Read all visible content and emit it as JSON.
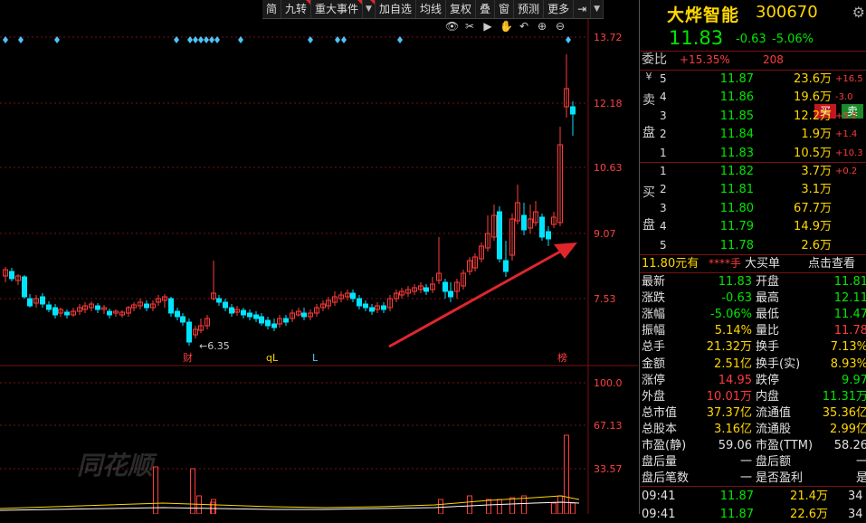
{
  "toolbar": {
    "items": [
      "简",
      "九转",
      "重大事件",
      "▼",
      "加自选",
      "均线",
      "复权",
      "叠",
      "窗",
      "预测",
      "更多",
      "⇥",
      "▼"
    ]
  },
  "chart_tools": [
    "👁",
    "✂",
    "▶",
    "✋",
    "↶",
    "⊕",
    "⊖"
  ],
  "price_axis": [
    "13.72",
    "12.18",
    "10.63",
    "9.07",
    "7.53"
  ],
  "volume_axis": [
    "100.0",
    "67.13",
    "33.57"
  ],
  "markers": {
    "low_label": "←6.35",
    "cai": "财",
    "ql": "qL",
    "l": "L",
    "bang": "榜"
  },
  "colors": {
    "up": "#ff3b3b",
    "down": "#00e5ff",
    "accent": "#ffd700",
    "grid": "#7a1010"
  },
  "stock": {
    "name": "大烨智能",
    "code": "300670",
    "price": "11.83",
    "change": "-0.63",
    "pct": "-5.06%"
  },
  "weibi": {
    "label": "委比",
    "value": "+15.35%",
    "diff": "208",
    "sell": "买",
    "buy": "卖"
  },
  "sell_side_label": [
    "卖",
    "盘"
  ],
  "buy_side_label": [
    "买",
    "盘"
  ],
  "asks": [
    {
      "lvl": "5",
      "price": "11.87",
      "vol": "23.6万",
      "chg": "+16.5"
    },
    {
      "lvl": "4",
      "price": "11.86",
      "vol": "19.6万",
      "chg": "-3.0"
    },
    {
      "lvl": "3",
      "price": "11.85",
      "vol": "12.2万",
      "chg": "+5.2"
    },
    {
      "lvl": "2",
      "price": "11.84",
      "vol": "1.9万",
      "chg": "+1.4"
    },
    {
      "lvl": "1",
      "price": "11.83",
      "vol": "10.5万",
      "chg": "+10.3"
    }
  ],
  "bids": [
    {
      "lvl": "1",
      "price": "11.82",
      "vol": "3.7万",
      "chg": "+0.2"
    },
    {
      "lvl": "2",
      "price": "11.81",
      "vol": "3.1万",
      "chg": ""
    },
    {
      "lvl": "3",
      "price": "11.80",
      "vol": "67.7万",
      "chg": ""
    },
    {
      "lvl": "4",
      "price": "11.79",
      "vol": "14.9万",
      "chg": ""
    },
    {
      "lvl": "5",
      "price": "11.78",
      "vol": "2.6万",
      "chg": ""
    }
  ],
  "big_order": {
    "price": "11.80元有",
    "stars": "****手",
    "label": "大买单",
    "link": "点击查看"
  },
  "stats": [
    {
      "k1": "最新",
      "v1": "11.83",
      "c1": "green",
      "k2": "开盘",
      "v2": "11.81",
      "c2": "green"
    },
    {
      "k1": "涨跌",
      "v1": "-0.63",
      "c1": "green",
      "k2": "最高",
      "v2": "12.11",
      "c2": "green"
    },
    {
      "k1": "涨幅",
      "v1": "-5.06%",
      "c1": "green",
      "k2": "最低",
      "v2": "11.47",
      "c2": "green"
    },
    {
      "k1": "振幅",
      "v1": "5.14%",
      "c1": "yellow",
      "k2": "量比",
      "v2": "11.78",
      "c2": "red"
    },
    {
      "k1": "总手",
      "v1": "21.32万",
      "c1": "yellow",
      "k2": "换手",
      "v2": "7.13%",
      "c2": "yellow"
    },
    {
      "k1": "金额",
      "v1": "2.51亿",
      "c1": "yellow",
      "k2": "换手(实)",
      "v2": "8.93%",
      "c2": "yellow"
    },
    {
      "k1": "涨停",
      "v1": "14.95",
      "c1": "red",
      "k2": "跌停",
      "v2": "9.97",
      "c2": "green"
    },
    {
      "k1": "外盘",
      "v1": "10.01万",
      "c1": "red",
      "k2": "内盘",
      "v2": "11.31万",
      "c2": "green"
    },
    {
      "k1": "总市值",
      "v1": "37.37亿",
      "c1": "yellow",
      "k2": "流通值",
      "v2": "35.36亿",
      "c2": "yellow"
    },
    {
      "k1": "总股本",
      "v1": "3.16亿",
      "c1": "yellow",
      "k2": "流通股",
      "v2": "2.99亿",
      "c2": "yellow"
    },
    {
      "k1": "市盈(静)",
      "v1": "59.06",
      "c1": "white",
      "k2": "市盈(TTM)",
      "v2": "58.26",
      "c2": "white"
    },
    {
      "k1": "盘后量",
      "v1": "一",
      "c1": "white",
      "k2": "盘后额",
      "v2": "一",
      "c2": "white"
    },
    {
      "k1": "盘后笔数",
      "v1": "一",
      "c1": "white",
      "k2": "是否盈利",
      "v2": "是",
      "c2": "white"
    }
  ],
  "ticks": [
    {
      "time": "09:41",
      "price": "11.87",
      "vol": "21.4万",
      "n": "34"
    },
    {
      "time": "09:41",
      "price": "11.87",
      "vol": "22.6万",
      "n": "34"
    }
  ],
  "watermark": "同花顺"
}
